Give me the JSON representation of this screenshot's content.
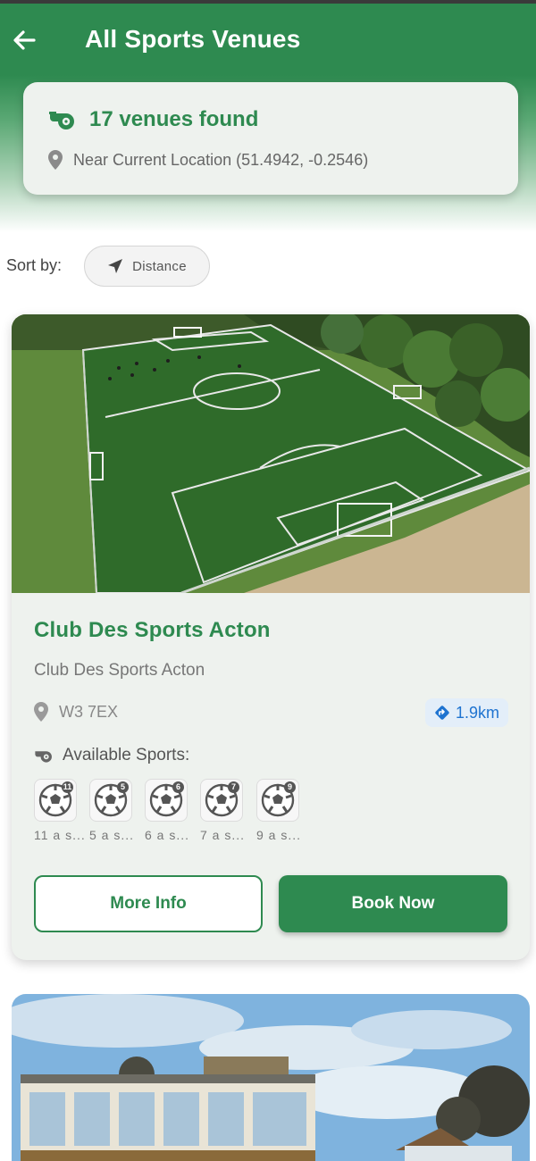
{
  "header": {
    "title": "All Sports Venues"
  },
  "summary": {
    "count_text": "17 venues found",
    "location_text": "Near Current Location (51.4942, -0.2546)"
  },
  "sort": {
    "label": "Sort by:",
    "selected": "Distance"
  },
  "venues": [
    {
      "name": "Club Des Sports Acton",
      "subtitle": "Club Des Sports Acton",
      "postcode": "W3 7EX",
      "distance": "1.9km",
      "sports_heading": "Available Sports:",
      "sports": [
        {
          "badge": "11",
          "label": "11 a s..."
        },
        {
          "badge": "5",
          "label": "5 a s..."
        },
        {
          "badge": "6",
          "label": "6 a s..."
        },
        {
          "badge": "7",
          "label": "7 a s..."
        },
        {
          "badge": "9",
          "label": "9 a s..."
        }
      ],
      "more_info_label": "More Info",
      "book_label": "Book Now"
    }
  ],
  "colors": {
    "brand_green": "#2e8a50",
    "distance_blue": "#1e73d0",
    "card_bg": "#eef2ee"
  },
  "icons": {
    "back": "arrow-left-icon",
    "whistle": "whistle-icon",
    "location": "location-pin-icon",
    "navigation": "navigation-arrow-icon",
    "directions": "directions-diamond-icon",
    "football": "football-icon"
  }
}
